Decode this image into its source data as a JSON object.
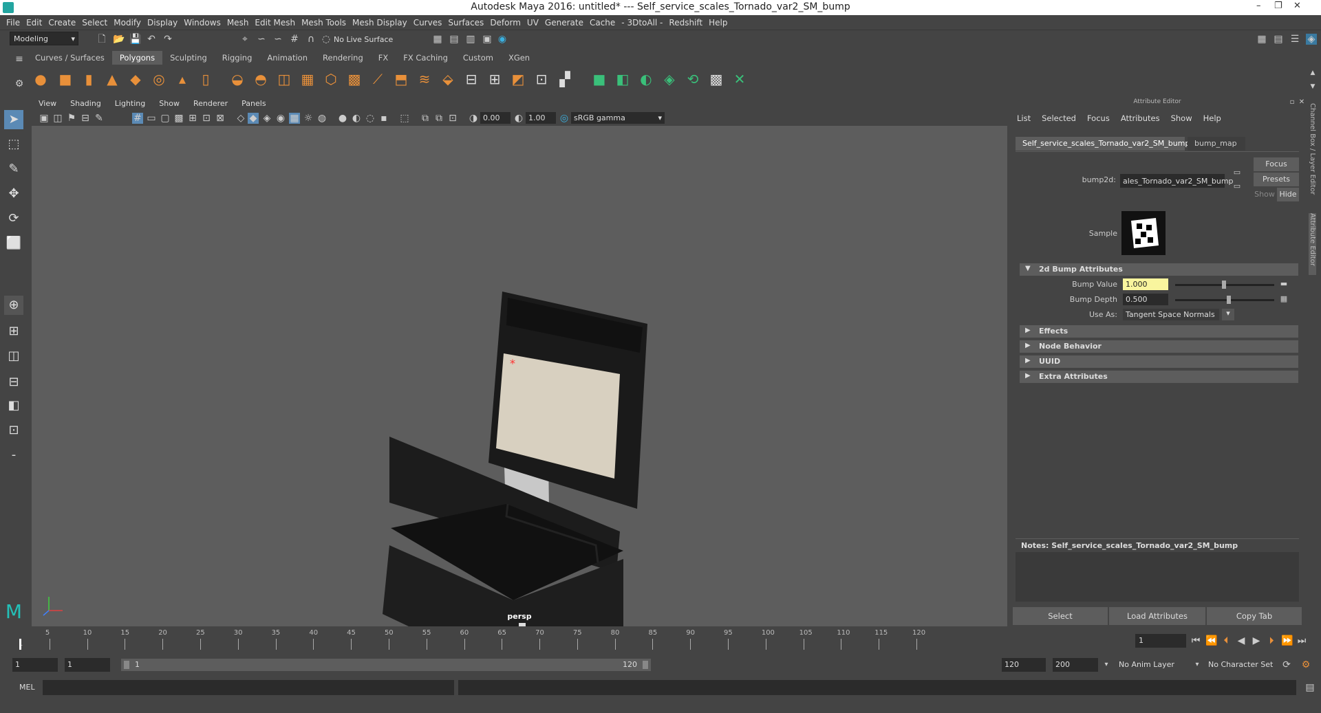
{
  "title": "Autodesk Maya 2016: untitled*   ---   Self_service_scales_Tornado_var2_SM_bump",
  "menus": [
    "File",
    "Edit",
    "Create",
    "Select",
    "Modify",
    "Display",
    "Windows",
    "Mesh",
    "Edit Mesh",
    "Mesh Tools",
    "Mesh Display",
    "Curves",
    "Surfaces",
    "Deform",
    "UV",
    "Generate",
    "Cache",
    "- 3DtoAll -",
    "Redshift",
    "Help"
  ],
  "mode_select": "Modeling",
  "live_surface": "No Live Surface",
  "shelf_tabs": [
    "Curves / Surfaces",
    "Polygons",
    "Sculpting",
    "Rigging",
    "Animation",
    "Rendering",
    "FX",
    "FX Caching",
    "Custom",
    "XGen"
  ],
  "active_shelf_tab": "Polygons",
  "viewport_menu": [
    "View",
    "Shading",
    "Lighting",
    "Show",
    "Renderer",
    "Panels"
  ],
  "viewport_toolbar": {
    "exposure": "0.00",
    "gamma": "1.00",
    "color_space": "sRGB gamma"
  },
  "viewport_label": "persp",
  "attribute_editor": {
    "header": "Attribute Editor",
    "menu": [
      "List",
      "Selected",
      "Focus",
      "Attributes",
      "Show",
      "Help"
    ],
    "tabs": [
      "Self_service_scales_Tornado_var2_SM_bump",
      "bump_map"
    ],
    "node_label": "bump2d:",
    "node_value": "ales_Tornado_var2_SM_bump",
    "buttons": {
      "focus": "Focus",
      "presets": "Presets",
      "show": "Show",
      "hide": "Hide"
    },
    "sample_label": "Sample",
    "sections": {
      "bump": "2d Bump Attributes",
      "effects": "Effects",
      "node_behavior": "Node Behavior",
      "uuid": "UUID",
      "extra": "Extra Attributes"
    },
    "attrs": {
      "bump_value_label": "Bump Value",
      "bump_value": "1.000",
      "bump_depth_label": "Bump Depth",
      "bump_depth": "0.500",
      "use_as_label": "Use As:",
      "use_as": "Tangent Space Normals"
    },
    "notes": "Notes:  Self_service_scales_Tornado_var2_SM_bump",
    "bottom_buttons": {
      "select": "Select",
      "load": "Load Attributes",
      "copy": "Copy Tab"
    }
  },
  "side_tabs": {
    "channel_box": "Channel Box / Layer Editor",
    "attribute_editor": "Attribute Editor"
  },
  "timeline": {
    "ticks": [
      "5",
      "10",
      "15",
      "20",
      "25",
      "30",
      "35",
      "40",
      "45",
      "50",
      "55",
      "60",
      "65",
      "70",
      "75",
      "80",
      "85",
      "90",
      "95",
      "100",
      "105",
      "110",
      "115",
      "120"
    ],
    "first_frame": "1",
    "current_frame": "1"
  },
  "range": {
    "start": "1",
    "playback_start": "1",
    "slider_start": "1",
    "slider_end": "120",
    "playback_end": "120",
    "end": "200",
    "anim_layer": "No Anim Layer",
    "char_set": "No Character Set"
  },
  "cmdline": {
    "lang": "MEL"
  }
}
